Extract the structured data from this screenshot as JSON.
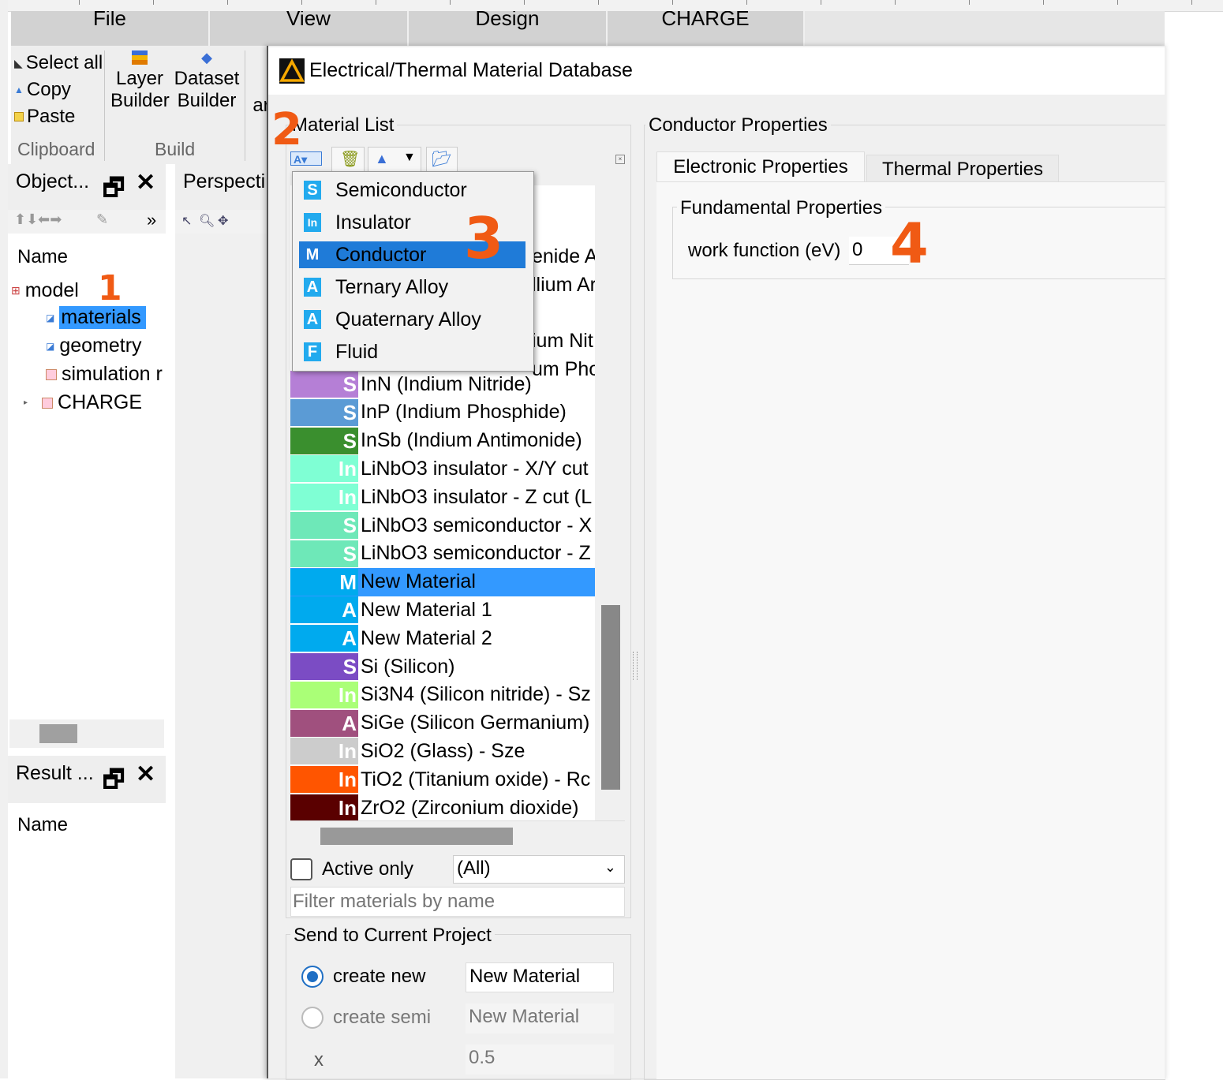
{
  "app": {
    "menu_tabs": [
      "File",
      "View",
      "Design",
      "CHARGE"
    ]
  },
  "ribbon": {
    "select_all": "Select all",
    "copy": "Copy",
    "paste": "Paste",
    "clipboard_group": "Clipboard",
    "layer_builder": "Layer\nBuilder",
    "dataset_builder": "Dataset\nBuilder",
    "an_label": "ar",
    "build_group": "Build"
  },
  "objects_panel": {
    "title": "Object...",
    "perspective_title": "Perspecti",
    "column_header": "Name",
    "tree": {
      "model": "model",
      "materials": "materials",
      "geometry": "geometry",
      "simulation": "simulation r",
      "charge": "CHARGE"
    }
  },
  "results_panel": {
    "title": "Result ...",
    "column_header": "Name"
  },
  "dialog": {
    "title": "Electrical/Thermal Material Database",
    "material_list_label": "Material List",
    "type_menu": [
      {
        "letter": "S",
        "label": "Semiconductor",
        "color": "#22aaee"
      },
      {
        "letter": "In",
        "label": "Insulator",
        "color": "#22aaee"
      },
      {
        "letter": "M",
        "label": "Conductor",
        "color": "#22aaee"
      },
      {
        "letter": "A",
        "label": "Ternary Alloy",
        "color": "#22aaee"
      },
      {
        "letter": "A",
        "label": "Quaternary Alloy",
        "color": "#22aaee"
      },
      {
        "letter": "F",
        "label": "Fluid",
        "color": "#22aaee"
      }
    ],
    "partial_rows": [
      "enide A",
      "llium Ar",
      "ium Nit",
      "um Pho"
    ],
    "materials": [
      {
        "letter": "S",
        "name": "InN (Indium Nitride)",
        "color": "#b57fd6"
      },
      {
        "letter": "S",
        "name": "InP (Indium Phosphide)",
        "color": "#5b9bd5"
      },
      {
        "letter": "S",
        "name": "InSb (Indium Antimonide)",
        "color": "#3a8f2e"
      },
      {
        "letter": "In",
        "name": "LiNbO3 insulator - X/Y cut",
        "color": "#7fffd4"
      },
      {
        "letter": "In",
        "name": "LiNbO3 insulator - Z cut (L",
        "color": "#7fffd4"
      },
      {
        "letter": "S",
        "name": "LiNbO3 semiconductor - X",
        "color": "#6ee8b8"
      },
      {
        "letter": "S",
        "name": "LiNbO3 semiconductor - Z",
        "color": "#6ee8b8"
      },
      {
        "letter": "M",
        "name": "New Material",
        "color": "#00aaee"
      },
      {
        "letter": "A",
        "name": "New Material 1",
        "color": "#00aaee"
      },
      {
        "letter": "A",
        "name": "New Material 2",
        "color": "#00aaee"
      },
      {
        "letter": "S",
        "name": "Si (Silicon)",
        "color": "#7b4cc4"
      },
      {
        "letter": "In",
        "name": "Si3N4 (Silicon nitride) - Sz",
        "color": "#aaff77"
      },
      {
        "letter": "A",
        "name": "SiGe (Silicon Germanium)",
        "color": "#a0507e"
      },
      {
        "letter": "In",
        "name": "SiO2 (Glass) - Sze",
        "color": "#cccccc"
      },
      {
        "letter": "In",
        "name": "TiO2 (Titanium oxide) - Rc",
        "color": "#ff5500"
      },
      {
        "letter": "In",
        "name": "ZrO2 (Zirconium dioxide)",
        "color": "#5a0000"
      }
    ],
    "selected_material": "New Material",
    "active_only_label": "Active only",
    "filter_select_value": "(All)",
    "filter_placeholder": "Filter materials by name",
    "send_group_label": "Send to Current Project",
    "create_new_label": "create new",
    "create_new_value": "New Material",
    "create_semi_label": "create semi",
    "create_semi_value": "New Material",
    "x_label": "x",
    "x_value": "0.5",
    "properties_label": "Conductor Properties",
    "tabs": [
      "Electronic Properties",
      "Thermal Properties"
    ],
    "fundamental_label": "Fundamental Properties",
    "work_function_label": "work function (eV)",
    "work_function_value": "0"
  },
  "annotations": [
    "1",
    "2",
    "3",
    "4"
  ],
  "colors": {
    "selection": "#3399ff",
    "menu_selection": "#1f7bd8",
    "annotation": "#f05a14"
  }
}
